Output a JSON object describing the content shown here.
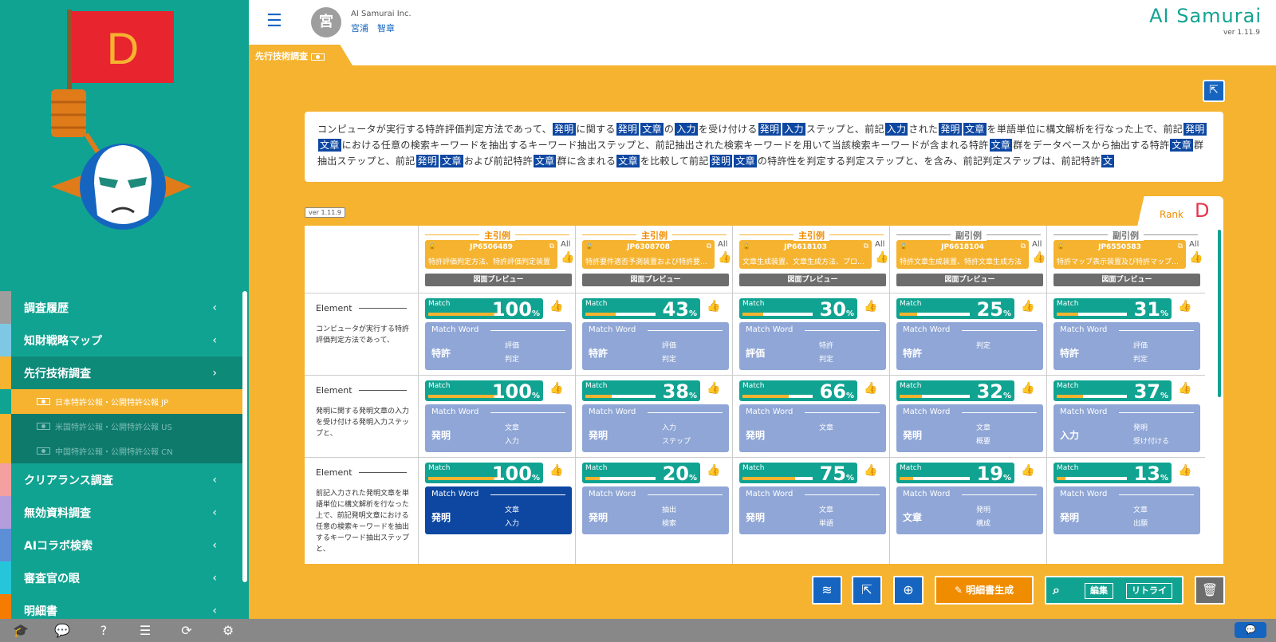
{
  "sidebar": {
    "rank_letter": "D",
    "items": [
      {
        "label": "調査履歴",
        "strip": "#9e9e9e"
      },
      {
        "label": "知財戦略マップ",
        "strip": "#7ec8e3"
      },
      {
        "label": "先行技術調査",
        "strip": "#f5b330"
      },
      {
        "label": "クリアランス調査",
        "strip": "#f4a0a0"
      },
      {
        "label": "無効資料調査",
        "strip": "#b39ddb"
      },
      {
        "label": "AIコラボ検索",
        "strip": "#5c8fd6"
      },
      {
        "label": "審査官の眼",
        "strip": "#26c6da"
      },
      {
        "label": "明細書",
        "strip": "#f57c00"
      }
    ],
    "subitems": [
      {
        "label": "日本特許公報・公開特許公報 JP"
      },
      {
        "label": "米国特許公報・公開特許公報 US"
      },
      {
        "label": "中国特許公報・公開特許公報 CN"
      }
    ]
  },
  "bottom_icons": [
    "graduation-icon",
    "faq-icon",
    "help-icon",
    "document-icon",
    "sync-icon",
    "gear-icon"
  ],
  "header": {
    "avatar": "宮",
    "company": "AI Samurai Inc.",
    "user": "宮浦　智章",
    "logo": "AI Samurai",
    "version": "ver 1.11.9"
  },
  "tab": {
    "label": "先行技術調査"
  },
  "claim": [
    {
      "t": "コンピュータが実行する特許評価判定方法であって、"
    },
    {
      "t": "発明",
      "h": true
    },
    {
      "t": "に関する"
    },
    {
      "t": "発明",
      "h": true
    },
    {
      "t": "文章",
      "h": true
    },
    {
      "t": "の"
    },
    {
      "t": "入力",
      "h": true
    },
    {
      "t": "を受け付ける"
    },
    {
      "t": "発明",
      "h": true
    },
    {
      "t": "入力",
      "h": true
    },
    {
      "t": "ステップと、前記"
    },
    {
      "t": "入力",
      "h": true
    },
    {
      "t": "された"
    },
    {
      "t": "発明",
      "h": true
    },
    {
      "t": "文章",
      "h": true
    },
    {
      "t": "を単語単位に構文解析を行なった上で、前記"
    },
    {
      "t": "発明",
      "h": true
    },
    {
      "t": "文章",
      "h": true
    },
    {
      "t": "における任意の検索キーワードを抽出するキーワード抽出ステップと、前記抽出された検索キーワードを用いて当該検索キーワードが含まれる特許"
    },
    {
      "t": "文章",
      "h": true
    },
    {
      "t": "群をデータベースから抽出する特許"
    },
    {
      "t": "文章",
      "h": true
    },
    {
      "t": "群抽出ステップと、前記"
    },
    {
      "t": "発明",
      "h": true
    },
    {
      "t": "文章",
      "h": true
    },
    {
      "t": "および前記特許"
    },
    {
      "t": "文章",
      "h": true
    },
    {
      "t": "群に含まれる"
    },
    {
      "t": "文章",
      "h": true
    },
    {
      "t": "を比較して前記"
    },
    {
      "t": "発明",
      "h": true
    },
    {
      "t": "文章",
      "h": true
    },
    {
      "t": "の特許性を判定する判定ステップと、を含み、前記判定ステップは、前記特許"
    },
    {
      "t": "文",
      "h": true
    }
  ],
  "ver_badge": "ver 1.11.9",
  "rank": {
    "label": "Rank",
    "value": "D"
  },
  "element_label": "Element",
  "preview_label": "図面プレビュー",
  "all_label": "All",
  "match_label": "Match",
  "match_word_label": "Match Word",
  "elements": [
    "コンピュータが実行する特許評価判定方法であって、",
    "発明に関する発明文章の入力を受け付ける発明入力ステップと、",
    "前記入力された発明文章を単語単位に構文解析を行なった上で、前記発明文章における任意の検索キーワードを抽出するキーワード抽出ステップと、"
  ],
  "patents": [
    {
      "kind": "主引例",
      "num": "JP6506489",
      "title": "特許評価判定方法、特許評価判定装置",
      "rows": [
        {
          "pct": 100,
          "main": "特許",
          "subs": [
            "評価",
            "判定"
          ]
        },
        {
          "pct": 100,
          "main": "発明",
          "subs": [
            "文章",
            "入力"
          ]
        },
        {
          "pct": 100,
          "main": "発明",
          "subs": [
            "文章",
            "入力"
          ],
          "dark": true
        }
      ]
    },
    {
      "kind": "主引例",
      "num": "JP6308708",
      "title": "特許要件適否予測装置および特許要件適否予測プログラム",
      "rows": [
        {
          "pct": 43,
          "main": "特許",
          "subs": [
            "評価",
            "判定"
          ]
        },
        {
          "pct": 38,
          "main": "発明",
          "subs": [
            "入力",
            "ステップ"
          ]
        },
        {
          "pct": 20,
          "main": "発明",
          "subs": [
            "抽出",
            "検索"
          ]
        }
      ]
    },
    {
      "kind": "主引例",
      "num": "JP6618103",
      "title": "文章生成装置、文章生成方法、プログラム",
      "rows": [
        {
          "pct": 30,
          "main": "評価",
          "subs": [
            "特許",
            "判定"
          ]
        },
        {
          "pct": 66,
          "main": "発明",
          "subs": [
            "文章",
            ""
          ]
        },
        {
          "pct": 75,
          "main": "発明",
          "subs": [
            "文章",
            "単語"
          ]
        }
      ]
    },
    {
      "kind": "副引例",
      "num": "JP6618104",
      "title": "特許文章生成装置、特許文章生成方法",
      "rows": [
        {
          "pct": 25,
          "main": "特許",
          "subs": [
            "判定",
            ""
          ]
        },
        {
          "pct": 32,
          "main": "発明",
          "subs": [
            "文章",
            "概要"
          ]
        },
        {
          "pct": 19,
          "main": "文章",
          "subs": [
            "発明",
            "構成"
          ]
        }
      ]
    },
    {
      "kind": "副引例",
      "num": "JP6550583",
      "title": "特許マップ表示装置及び特許マップ表示方法",
      "rows": [
        {
          "pct": 31,
          "main": "特許",
          "subs": [
            "評価",
            "判定"
          ]
        },
        {
          "pct": 37,
          "main": "入力",
          "subs": [
            "発明",
            "受け付ける"
          ]
        },
        {
          "pct": 13,
          "main": "発明",
          "subs": [
            "文章",
            "出願"
          ]
        }
      ]
    }
  ],
  "actions": {
    "generate_label": "明細書生成",
    "edit_label": "編集",
    "retry_label": "リトライ"
  },
  "colors": {
    "teal": "#11a391",
    "orange": "#f5b330",
    "blue": "#1565c0",
    "red": "#e8334a"
  }
}
